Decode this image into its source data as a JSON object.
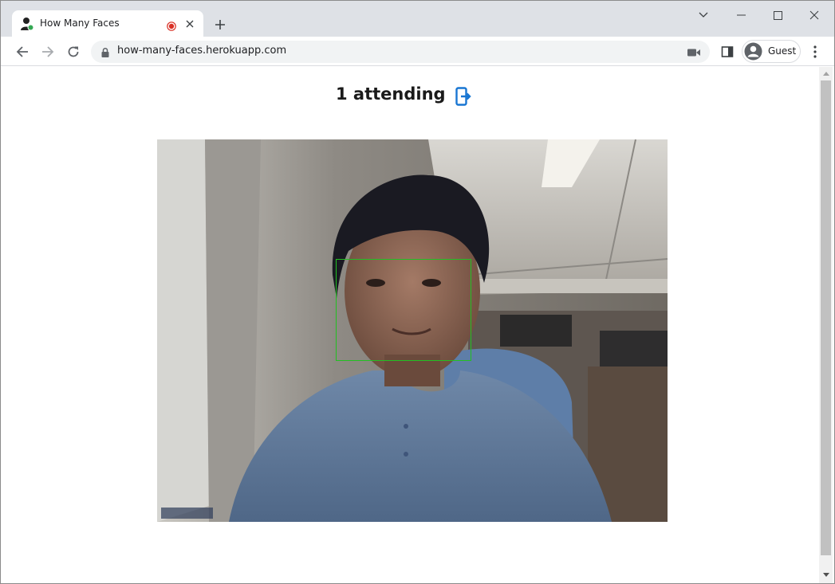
{
  "browser": {
    "tab": {
      "title": "How Many Faces",
      "favicon": "person-icon",
      "status_icon": "recording-dot-icon"
    },
    "address_bar": {
      "url": "how-many-faces.herokuapp.com"
    },
    "profile": {
      "name": "Guest"
    },
    "icons": {
      "back": "back-arrow-icon",
      "forward": "forward-arrow-icon",
      "reload": "reload-icon",
      "lock": "lock-icon",
      "camera": "camera-icon",
      "side_panel": "side-panel-icon",
      "menu": "kebab-menu-icon",
      "new_tab": "plus-icon",
      "tab_search": "chevron-down-icon",
      "minimize": "minimize-icon",
      "maximize": "maximize-icon",
      "close": "close-icon"
    }
  },
  "page": {
    "heading": "1 attending",
    "leave_icon": "exit-door-icon",
    "video": {
      "description_icon": "webcam-video-feed",
      "face_box_color": "#22c022"
    },
    "colors": {
      "accent": "#1976d2",
      "face_box": "#22c022"
    }
  }
}
